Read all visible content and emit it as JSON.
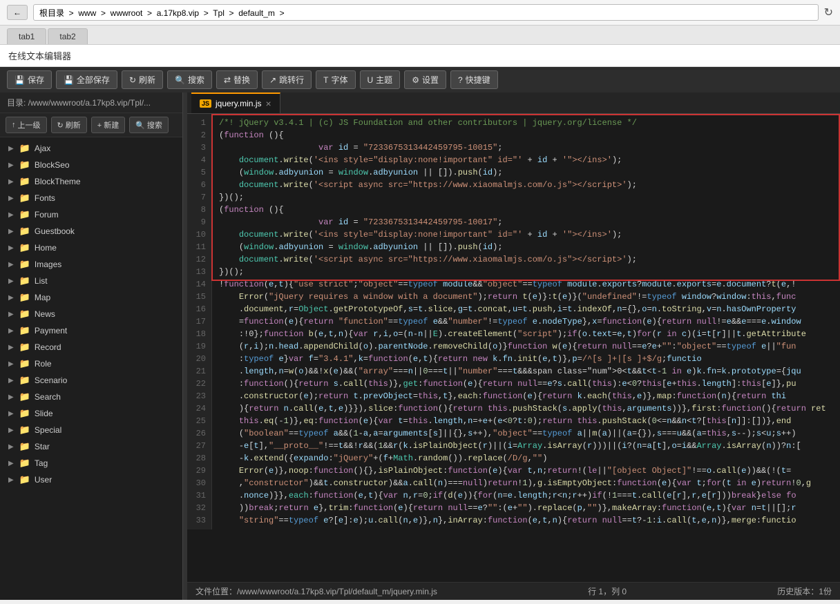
{
  "addressBar": {
    "backBtn": "←",
    "breadcrumb": "根目录  >  www  >  wwwroot  >  a.17kp8.vip  >  Tpl  >  default_m  >",
    "reloadIcon": "↻"
  },
  "appTabs": [
    {
      "label": "tab1",
      "active": false
    },
    {
      "label": "tab2",
      "active": false
    }
  ],
  "appTitle": "在线文本编辑器",
  "toolbar": {
    "save": "保存",
    "saveAll": "全部保存",
    "refresh": "刷新",
    "search": "搜索",
    "replace": "替换",
    "jump": "跳转行",
    "font": "字体",
    "theme": "主题",
    "settings": "设置",
    "shortcut": "快捷键"
  },
  "sidebar": {
    "pathLabel": "目录: /www/wwwroot/a.17kp8.vip/Tpl/...",
    "upBtn": "上一级",
    "refreshBtn": "刷新",
    "newBtn": "+ 新建",
    "searchBtn": "搜索",
    "items": [
      "Ajax",
      "BlockSeo",
      "BlockTheme",
      "Fonts",
      "Forum",
      "Guestbook",
      "Home",
      "Images",
      "List",
      "Map",
      "News",
      "Payment",
      "Record",
      "Role",
      "Scenario",
      "Search",
      "Slide",
      "Special",
      "Star",
      "Tag",
      "User"
    ]
  },
  "editorTab": {
    "jsIconLabel": "JS",
    "filename": "jquery.min.js",
    "closeIcon": "×"
  },
  "statusBar": {
    "filePath": "文件位置：/www/wwwroot/a.17kp8.vip/Tpl/default_m/jquery.min.js",
    "position": "行 1，列 0",
    "history": "历史版本：1份"
  }
}
